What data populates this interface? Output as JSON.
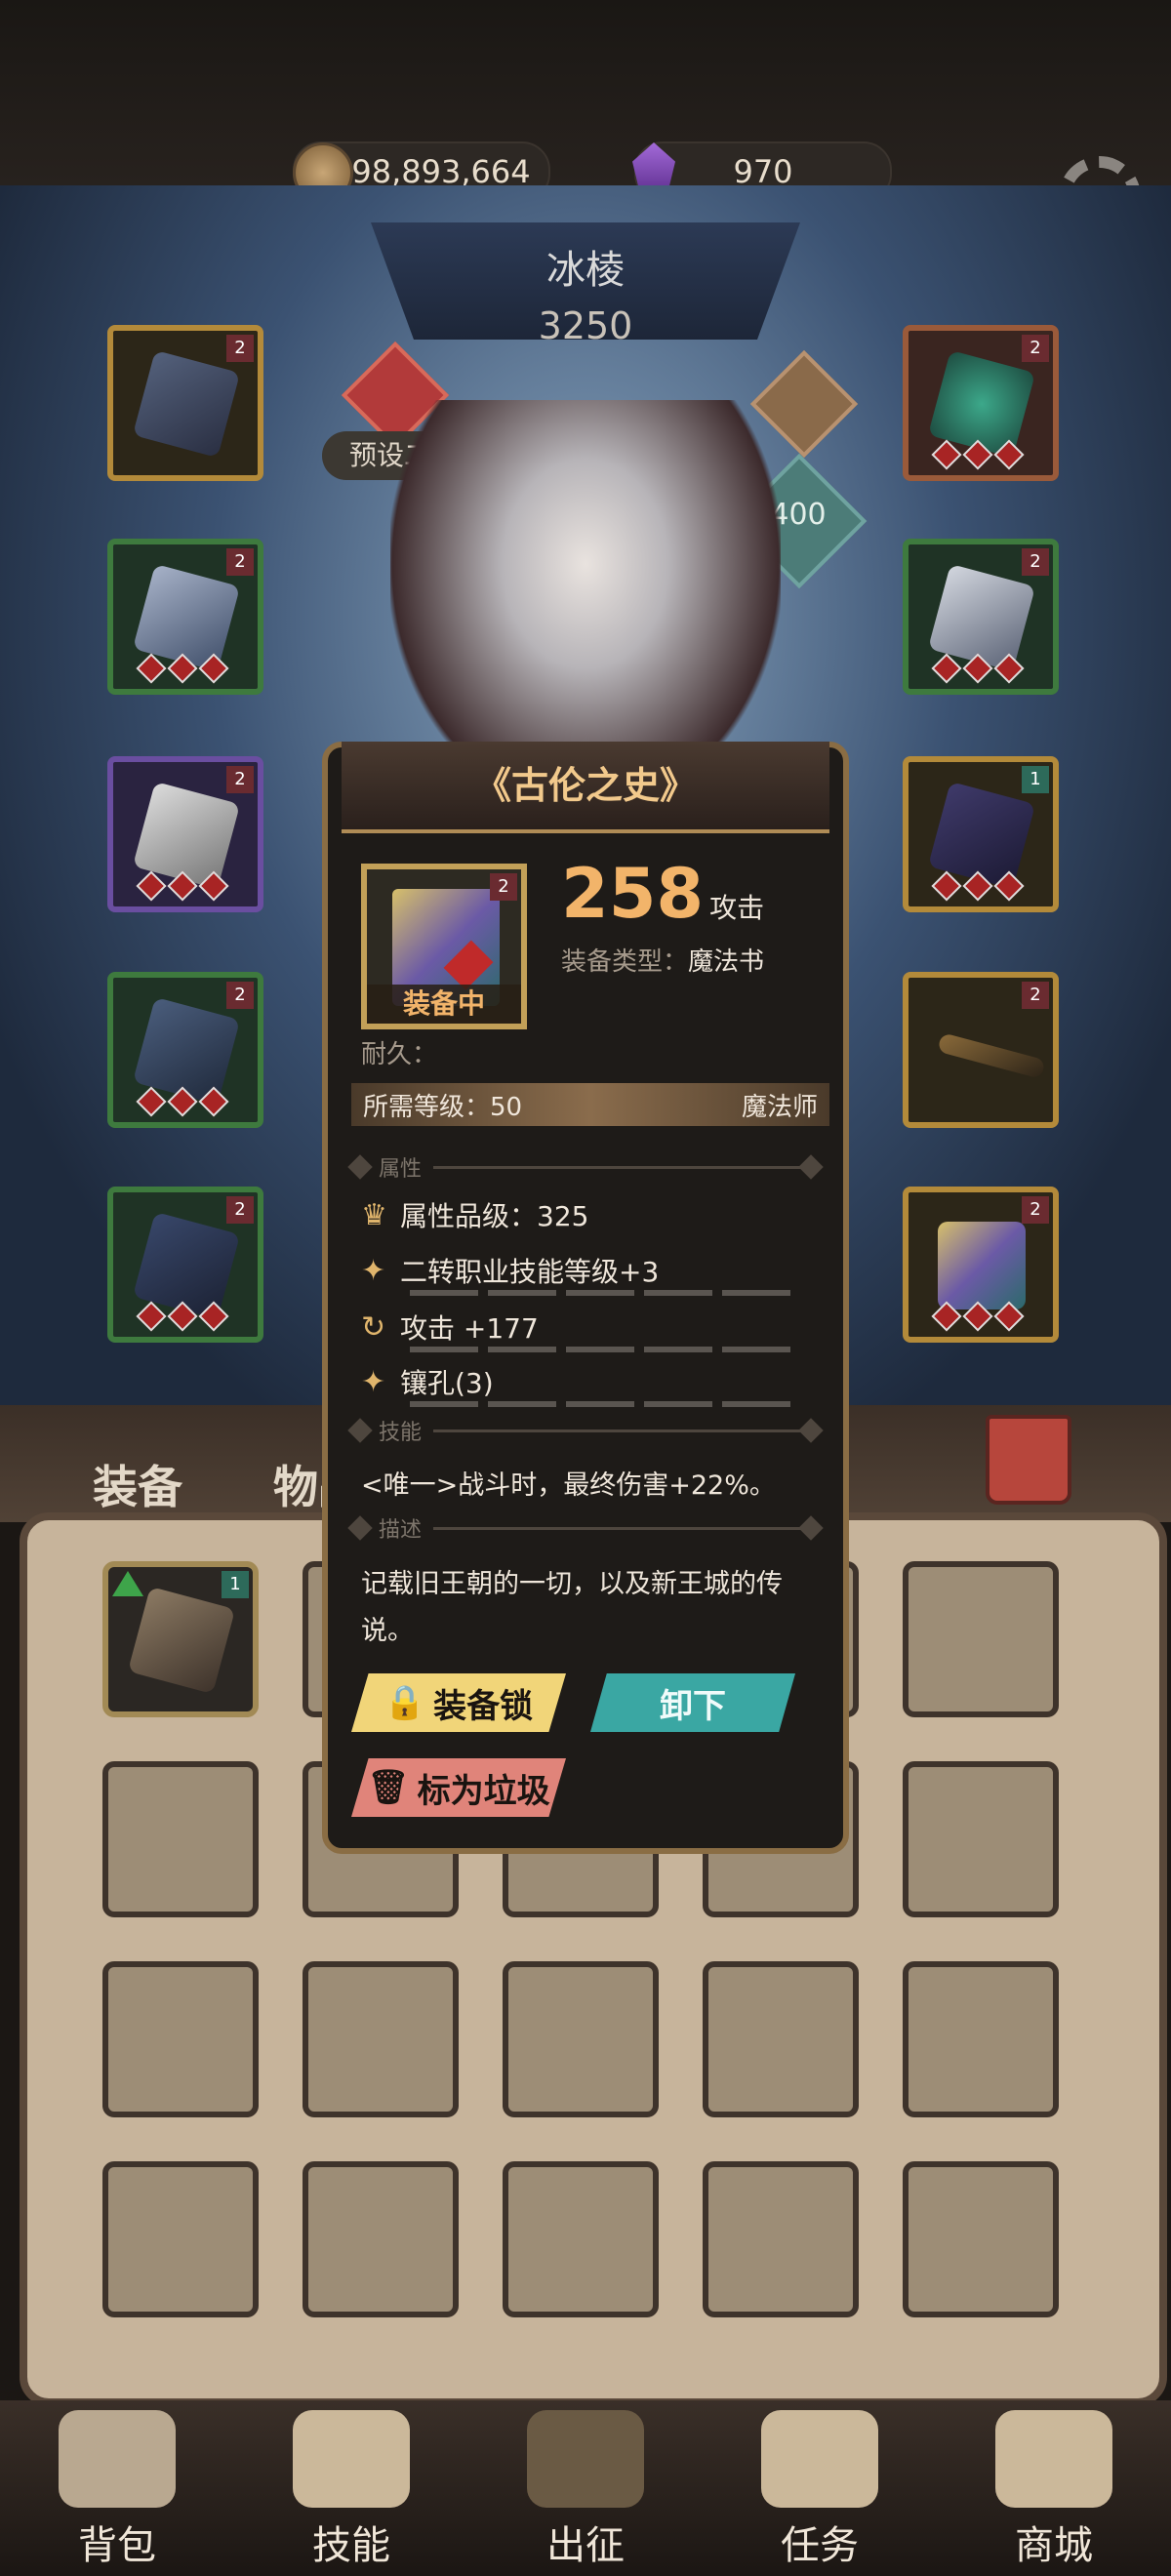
{
  "currency": {
    "gold": "98,893,664",
    "gems": "970"
  },
  "hero": {
    "name": "冰棱",
    "power": "3250",
    "preset": "预设二",
    "level": "400"
  },
  "tabs": {
    "equipment": "装备",
    "items": "物品"
  },
  "popup": {
    "title": "《古伦之史》",
    "attack_value": "258",
    "attack_unit": "攻击",
    "type_label": "装备类型：",
    "type_value": "魔法书",
    "equipped": "装备中",
    "durability": "耐久：",
    "req_level": "所需等级：50",
    "class": "魔法师",
    "section_attr": "属性",
    "attr_quality": "属性品级：325",
    "attr_1": "二转职业技能等级+3",
    "attr_2": "攻击 +177",
    "attr_3": "镶孔(3)",
    "section_skill": "技能",
    "skill_text": "<唯一>战斗时，最终伤害+22%。",
    "section_desc": "描述",
    "desc_text": "记载旧王朝的一切，以及新王城的传说。",
    "lock_button": "装备锁",
    "unequip_button": "卸下",
    "trash_button": "标为垃圾",
    "item_badge": "2"
  },
  "nav": {
    "bag": "背包",
    "skills": "技能",
    "battle": "出征",
    "quests": "任务",
    "shop": "商城"
  },
  "colors": {
    "accent_gold": "#f2c98c",
    "teal_button": "#3aa7a3",
    "yellow_button": "#f1d579",
    "red_button": "#e0847a"
  }
}
